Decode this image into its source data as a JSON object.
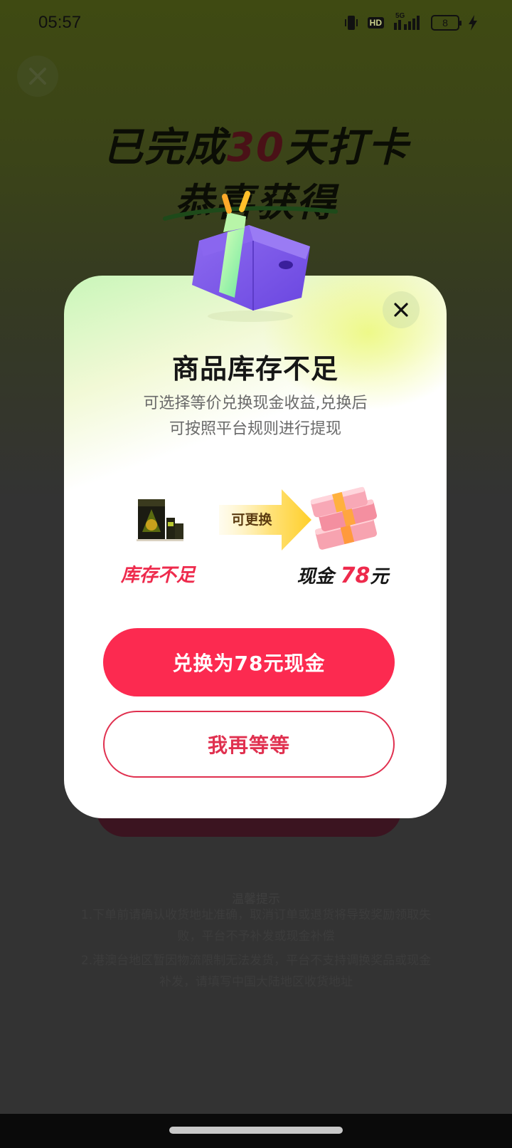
{
  "status_bar": {
    "time": "05:57",
    "network_label": "5G",
    "hd_label": "HD",
    "battery_level": "8"
  },
  "background_page": {
    "headline_prefix": "已完成",
    "headline_number": "30",
    "headline_suffix": "天打卡",
    "subhead": "恭喜获得",
    "tips_title": "温馨提示",
    "tips": [
      "1.下单前请确认收货地址准确，取消订单或退货将导致奖励领取失败，平台不予补发或现金补偿",
      "2.港澳台地区暂因物流限制无法发货，平台不支持调换奖品或现金补发，请填写中国大陆地区收货地址"
    ]
  },
  "modal": {
    "title": "商品库存不足",
    "desc_line1": "可选择等价兑换现金收益,兑换后",
    "desc_line2": "可按照平台规则进行提现",
    "arrow_label": "可更换",
    "stock_label": "库存不足",
    "cash_prefix": "现金",
    "cash_amount": "78",
    "cash_unit": "元",
    "primary_button": "兑换为78元现金",
    "secondary_button": "我再等等"
  },
  "colors": {
    "primary": "#fc2a50",
    "secondary_border": "#e0304f",
    "title": "#161616",
    "desc": "#6a6a6a"
  },
  "icons": {
    "close": "close-icon",
    "vibrate": "vibrate-icon",
    "signal": "signal-icon",
    "charging": "charging-icon"
  }
}
